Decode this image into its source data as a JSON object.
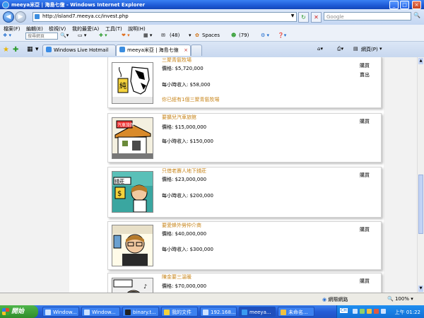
{
  "window": {
    "title": "meeya米亞 | 海島七億 - Windows Internet Explorer"
  },
  "address": {
    "url": "http://island7.meeya.cc/invest.php"
  },
  "search": {
    "placeholder": "Google"
  },
  "menu": {
    "items": [
      "檔案(F)",
      "編輯(E)",
      "檢視(V)",
      "我的最愛(A)",
      "工具(T)",
      "說明(H)"
    ]
  },
  "toolbar": {
    "search_placeholder": "搜尋網頁",
    "mail_count": "(48)",
    "spaces_label": "Spaces",
    "msg_count": "(79)"
  },
  "tabs": [
    {
      "label": "Windows Live Hotmail"
    },
    {
      "label": "meeya米亞 | 海島七億"
    }
  ],
  "tab_tools": {
    "page_label": "網頁(P)"
  },
  "labels": {
    "buy": "購買",
    "sell": "賣出"
  },
  "investments": [
    {
      "title": "三聚青氨牧場",
      "price": "價格: $5,720,000",
      "income": "每小時收入: $58,000",
      "note": "你已經有1個三聚青氨牧場",
      "can_sell": true
    },
    {
      "title": "要擴兒汽車旅館",
      "price": "價格: $15,000,000",
      "income": "每小時收入: $150,000",
      "note": "",
      "can_sell": false
    },
    {
      "title": "只借老賽人地下錢莊",
      "price": "價格: $23,000,000",
      "income": "每小時收入: $200,000",
      "note": "",
      "can_sell": false
    },
    {
      "title": "要愛蜂外勞仲介商",
      "price": "價格: $40,000,000",
      "income": "每小時收入: $300,000",
      "note": "",
      "can_sell": false
    },
    {
      "title": "陳金要三溫暖",
      "price": "價格: $70,000,000",
      "income": "",
      "note": "",
      "can_sell": false
    }
  ],
  "sign_texts": {
    "pure": "純",
    "motel": "汽車旅館",
    "bank": "錢莊"
  },
  "status": {
    "zone": "網際網路",
    "zoom": "100%"
  },
  "taskbar": {
    "start_label": "開始",
    "tasks": [
      "Window...",
      "Window...",
      "binary.t...",
      "我的文件",
      "192.168...",
      "meeya...",
      "未命名..."
    ],
    "lang": "CH",
    "clock": "上午 01:22"
  },
  "colors": {
    "accent_title": "#c8861c",
    "titlebar": "#1d5ad6",
    "taskbar": "#245dd7"
  }
}
